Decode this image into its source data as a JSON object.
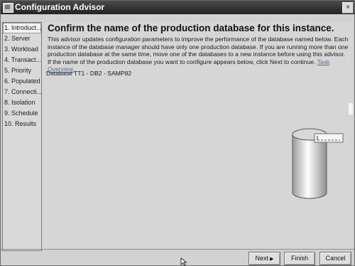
{
  "window": {
    "title": "Configuration Advisor"
  },
  "titlebar": {
    "close_symbol": "×"
  },
  "sidebar": {
    "items": [
      {
        "label": "1. Introduct..."
      },
      {
        "label": "2. Server"
      },
      {
        "label": "3. Workload"
      },
      {
        "label": "4. Transact..."
      },
      {
        "label": "5. Priority"
      },
      {
        "label": "6. Populated"
      },
      {
        "label": "7. Connecti..."
      },
      {
        "label": "8. Isolation"
      },
      {
        "label": "9. Schedule"
      },
      {
        "label": "10. Results"
      }
    ]
  },
  "main": {
    "heading": "Confirm the name of the production database for this instance.",
    "paragraph": "This advisor updates configuration parameters to improve the performance of the database named below. Each instance of the database manager should have only one production database. If you are running more than one production database at the same time, move one of the databases to a new instance before using this advisor. If the name of the production database you want to configure appears below, click Next to continue.",
    "link": "Task Overview.",
    "database_line": "Database TT1 - DB2 - SAMP82"
  },
  "buttons": {
    "next": "Next",
    "next_arrow": "▶",
    "finish": "Finish",
    "cancel": "Cancel"
  }
}
